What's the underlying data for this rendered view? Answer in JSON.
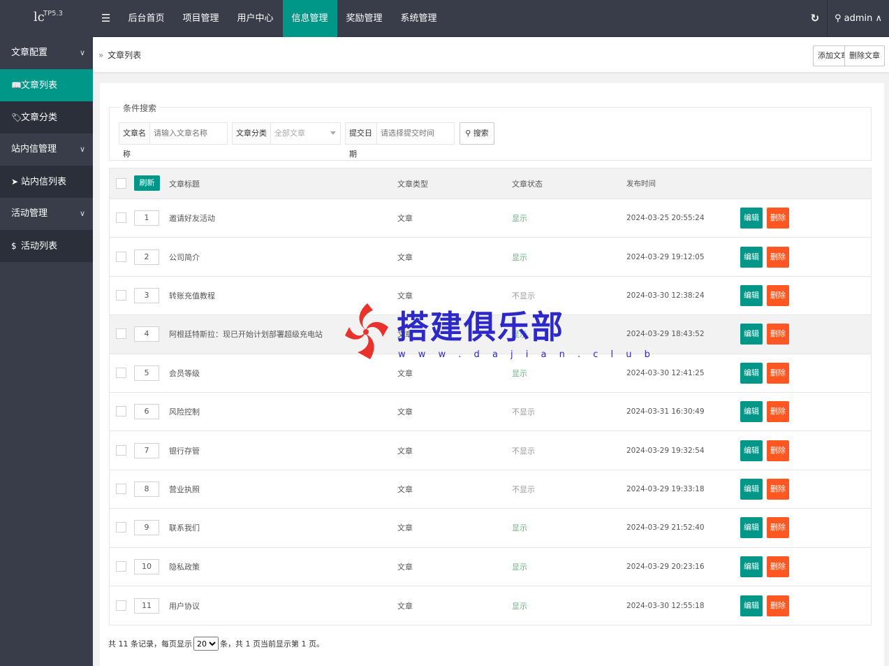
{
  "logo": {
    "text": "lc",
    "version": "TP5.3"
  },
  "topnav": {
    "toggle": "☰",
    "items": [
      "后台首页",
      "项目管理",
      "用户中心",
      "信息管理",
      "奖励管理",
      "系统管理"
    ],
    "refresh_icon": "↻",
    "user": "admin",
    "user_chevron": "∧"
  },
  "sidebar": {
    "items": [
      {
        "label": "文章配置",
        "kind": "group",
        "icon": ""
      },
      {
        "label": "文章列表",
        "kind": "sub",
        "icon": "📖",
        "active": true
      },
      {
        "label": "文章分类",
        "kind": "sub",
        "icon": "🏷"
      },
      {
        "label": "站内信管理",
        "kind": "group",
        "icon": ""
      },
      {
        "label": "站内信列表",
        "kind": "sub",
        "icon": "➤"
      },
      {
        "label": "活动管理",
        "kind": "group",
        "icon": ""
      },
      {
        "label": "活动列表",
        "kind": "sub",
        "icon": "$"
      }
    ],
    "chevron": "∨"
  },
  "breadcrumb": {
    "arrow": "»",
    "text": "文章列表"
  },
  "actions": {
    "add": "添加文章",
    "delete": "删除文章"
  },
  "search": {
    "legend": "条件搜索",
    "name_label": "文章名称",
    "name_placeholder": "请输入文章名称",
    "category_label": "文章分类",
    "category_value": "全部文章",
    "date_label": "提交日期",
    "date_placeholder": "请选择提交时间",
    "button": "搜索"
  },
  "table": {
    "refresh": "刷新",
    "headers": {
      "title": "文章标题",
      "type": "文章类型",
      "status": "文章状态",
      "time": "发布时间"
    },
    "edit_label": "编辑",
    "delete_label": "删除",
    "rows": [
      {
        "idx": "1",
        "title": "邀请好友活动",
        "type": "文章",
        "status": "显示",
        "on": true,
        "time": "2024-03-25 20:55:24"
      },
      {
        "idx": "2",
        "title": "公司简介",
        "type": "文章",
        "status": "显示",
        "on": true,
        "time": "2024-03-29 19:12:05"
      },
      {
        "idx": "3",
        "title": "转账充值教程",
        "type": "文章",
        "status": "不显示",
        "on": false,
        "time": "2024-03-30 12:38:24"
      },
      {
        "idx": "4",
        "title": "阿根廷特斯拉：现已开始计划部署超级充电站",
        "type": "文章",
        "status": "显示",
        "on": true,
        "time": "2024-03-29 18:43:52"
      },
      {
        "idx": "5",
        "title": "会员等级",
        "type": "文章",
        "status": "显示",
        "on": true,
        "time": "2024-03-30 12:41:25"
      },
      {
        "idx": "6",
        "title": "风险控制",
        "type": "文章",
        "status": "不显示",
        "on": false,
        "time": "2024-03-31 16:30:49"
      },
      {
        "idx": "7",
        "title": "银行存管",
        "type": "文章",
        "status": "不显示",
        "on": false,
        "time": "2024-03-29 19:32:54"
      },
      {
        "idx": "8",
        "title": "营业执照",
        "type": "文章",
        "status": "不显示",
        "on": false,
        "time": "2024-03-29 19:33:18"
      },
      {
        "idx": "9",
        "title": "联系我们",
        "type": "文章",
        "status": "显示",
        "on": true,
        "time": "2024-03-29 21:52:40"
      },
      {
        "idx": "10",
        "title": "隐私政策",
        "type": "文章",
        "status": "显示",
        "on": true,
        "time": "2024-03-29 20:23:16"
      },
      {
        "idx": "11",
        "title": "用户协议",
        "type": "文章",
        "status": "显示",
        "on": true,
        "time": "2024-03-30 12:55:18"
      }
    ]
  },
  "pager": {
    "prefix": "共 11 条记录，每页显示",
    "page_size": "20",
    "suffix": "条，共 1 页当前显示第 1 页。"
  },
  "watermark": {
    "text": "搭建俱乐部",
    "url": "w w w . d a j i a n . c l u b"
  },
  "colors": {
    "accent": "#009688",
    "danger": "#FF5722",
    "status_on": "#5FB878",
    "dark": "#393d49"
  }
}
